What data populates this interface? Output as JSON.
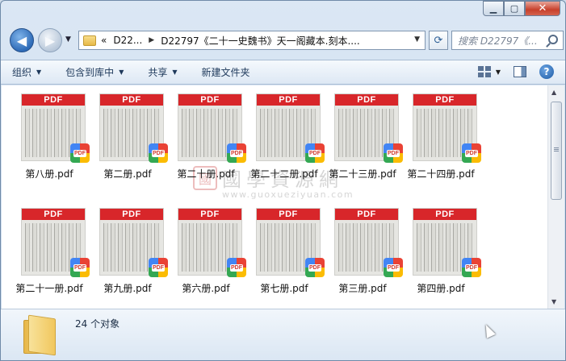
{
  "address": {
    "crumbs": [
      "«",
      "D22...",
      "D22797《二十一史魏书》天一阁藏本.刻本...."
    ]
  },
  "search": {
    "placeholder": "搜索 D22797《..."
  },
  "toolbar": {
    "organize": "组织",
    "include_in_library": "包含到库中",
    "share": "共享",
    "new_folder": "新建文件夹"
  },
  "files": [
    {
      "name": "第八册.pdf"
    },
    {
      "name": "第二册.pdf"
    },
    {
      "name": "第二十册.pdf"
    },
    {
      "name": "第二十二册.pdf"
    },
    {
      "name": "第二十三册.pdf"
    },
    {
      "name": "第二十四册.pdf"
    },
    {
      "name": "第二十一册.pdf"
    },
    {
      "name": "第九册.pdf"
    },
    {
      "name": "第六册.pdf"
    },
    {
      "name": "第七册.pdf"
    },
    {
      "name": "第三册.pdf"
    },
    {
      "name": "第四册.pdf"
    }
  ],
  "thumb_band_text": "PDF",
  "badge_text": "PDF",
  "watermark": {
    "seal": "國",
    "title": "國學資源網",
    "url": "www.guoxueziyuan.com"
  },
  "status": {
    "count": "24 个对象"
  },
  "icons": {
    "back": "back-arrow-icon",
    "forward": "forward-arrow-icon",
    "refresh": "refresh-icon",
    "search": "search-icon",
    "help": "help-icon",
    "folder": "folder-icon"
  }
}
